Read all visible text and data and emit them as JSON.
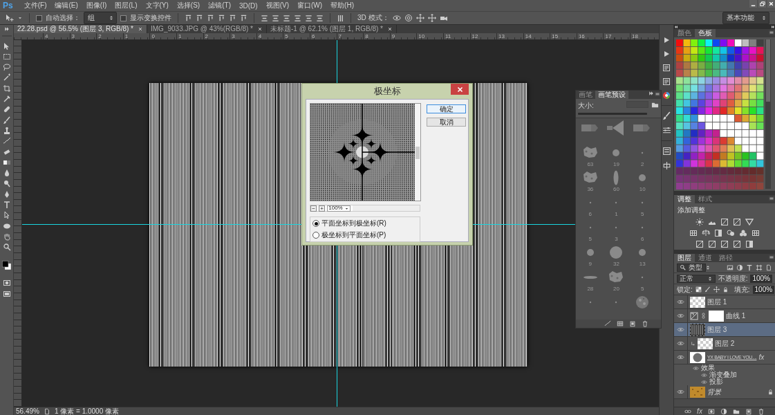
{
  "app": {
    "logo": "Ps"
  },
  "menu": [
    "文件(F)",
    "编辑(E)",
    "图像(I)",
    "图层(L)",
    "文字(Y)",
    "选择(S)",
    "滤镜(T)",
    "3D(D)",
    "视图(V)",
    "窗口(W)",
    "帮助(H)"
  ],
  "options": {
    "auto_select": {
      "label": "自动选择：",
      "checked": false,
      "value": "组"
    },
    "show_transform": {
      "label": "显示变换控件",
      "checked": false
    },
    "mode_label": "3D 模式：",
    "workspace": "基本功能"
  },
  "tabs": [
    {
      "label": "22.28.psd @ 56.5% (图层 3, RGB/8) *",
      "selected": true
    },
    {
      "label": "IMG_9033.JPG @ 43%(RGB/8) *",
      "selected": false
    },
    {
      "label": "未标题-1 @ 62.1% (图层 1, RGB/8) *",
      "selected": false
    }
  ],
  "ruler": [
    "4",
    "3",
    "2",
    "1",
    "0",
    "1",
    "2",
    "3",
    "4",
    "5",
    "6",
    "7",
    "8",
    "9",
    "10",
    "11",
    "12",
    "13",
    "14",
    "15",
    "16",
    "17",
    "18"
  ],
  "status_bar": {
    "zoom": "56.49%",
    "info": "1 像素 = 1.0000 像素"
  },
  "dialog": {
    "title": "极坐标",
    "zoom_out": "−",
    "zoom_in": "+",
    "zoom": "100%",
    "buttons": [
      {
        "label": "确定",
        "default": true
      },
      {
        "label": "取消",
        "default": false
      }
    ],
    "options": [
      {
        "label": "平面坐标到极坐标(R)",
        "selected": true
      },
      {
        "label": "极坐标到平面坐标(P)",
        "selected": false
      }
    ]
  },
  "brushes": {
    "tabs": [
      {
        "label": "画笔",
        "selected": false
      },
      {
        "label": "画笔预设",
        "selected": true
      }
    ],
    "size_label": "大小:",
    "presets": [
      {
        "kind": "bristle"
      },
      {
        "kind": "fan"
      },
      {
        "kind": "bristle"
      },
      {
        "kind": "scatter",
        "label": "63"
      },
      {
        "kind": "round",
        "label": "19"
      },
      {
        "kind": "dot",
        "label": "2"
      },
      {
        "kind": "scatter",
        "label": "36"
      },
      {
        "kind": "ellipse",
        "label": "60"
      },
      {
        "kind": "round",
        "label": "10"
      },
      {
        "kind": "dot",
        "label": "6"
      },
      {
        "kind": "dot",
        "label": "1"
      },
      {
        "kind": "dot",
        "label": "5"
      },
      {
        "kind": "dot",
        "label": "5"
      },
      {
        "kind": "dot",
        "label": "3"
      },
      {
        "kind": "dot",
        "label": "6"
      },
      {
        "kind": "round",
        "label": "9"
      },
      {
        "kind": "soft",
        "label": "32"
      },
      {
        "kind": "round",
        "label": "13"
      },
      {
        "kind": "flat",
        "label": "28"
      },
      {
        "kind": "scatter",
        "label": "20"
      },
      {
        "kind": "dot",
        "label": "5"
      },
      {
        "kind": "dot"
      },
      {
        "kind": "dot"
      },
      {
        "kind": "noise"
      }
    ]
  },
  "color_panel": {
    "tabs": [
      {
        "label": "颜色",
        "selected": false
      },
      {
        "label": "色板",
        "selected": true
      }
    ]
  },
  "adjustments": {
    "tabs": [
      {
        "label": "调整",
        "selected": true
      },
      {
        "label": "样式",
        "selected": false
      }
    ],
    "title": "添加调整"
  },
  "layers": {
    "tabs": [
      {
        "label": "图层",
        "selected": true
      },
      {
        "label": "通道",
        "selected": false
      },
      {
        "label": "路径",
        "selected": false
      }
    ],
    "filter": "类型",
    "blend_mode": "正常",
    "opacity_label": "不透明度:",
    "opacity": "100%",
    "lock_label": "锁定:",
    "fill_label": "填充:",
    "fill": "100%",
    "footer_fx": "fx",
    "items": [
      {
        "name": "图层 1",
        "kind": "pixel",
        "visible": true,
        "selected": false,
        "clipped": false
      },
      {
        "name": "曲线 1",
        "kind": "curves",
        "visible": true,
        "selected": false,
        "clipped": false
      },
      {
        "name": "图层 3",
        "kind": "stripes",
        "visible": true,
        "selected": true,
        "clipped": false
      },
      {
        "name": "图层 2",
        "kind": "pixel",
        "visible": true,
        "selected": false,
        "clipped": true
      },
      {
        "name": "YX BABY I LOVE YOU....",
        "kind": "shape",
        "visible": true,
        "selected": false,
        "clipped": false,
        "fx": "fx",
        "children": [
          {
            "name": "效果",
            "visible": true,
            "children": [
              {
                "name": "渐变叠加",
                "visible": true
              },
              {
                "name": "投影",
                "visible": true
              }
            ]
          }
        ]
      },
      {
        "name": "背景",
        "kind": "background",
        "visible": true,
        "selected": false,
        "clipped": false,
        "locked": true
      }
    ]
  }
}
